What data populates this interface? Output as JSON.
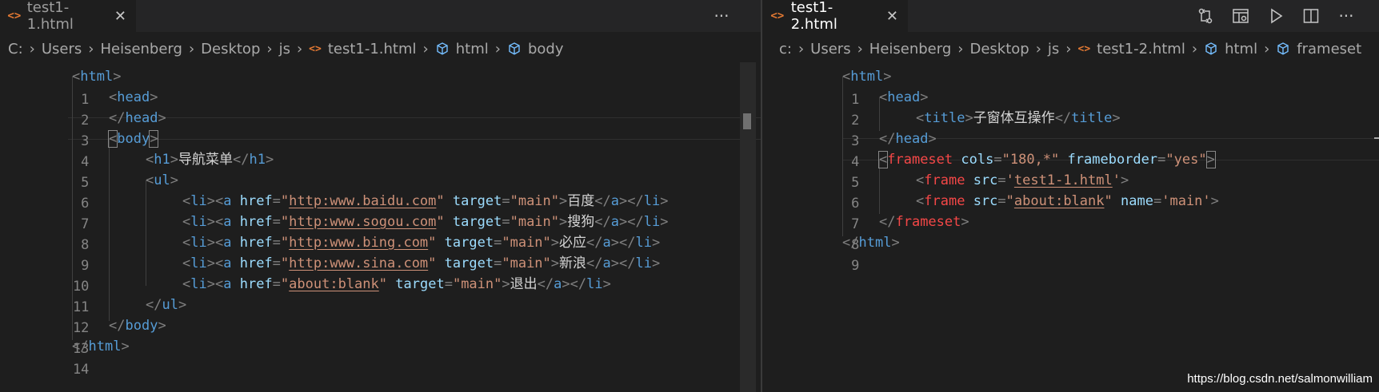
{
  "left": {
    "tab": {
      "title": "test1-1.html",
      "close_glyph": "✕",
      "file_icon": "<>"
    },
    "more_actions": "···",
    "breadcrumb": [
      "C:",
      "Users",
      "Heisenberg",
      "Desktop",
      "js",
      "test1-1.html",
      "html",
      "body"
    ],
    "line_numbers": [
      "1",
      "2",
      "3",
      "4",
      "5",
      "6",
      "7",
      "8",
      "9",
      "10",
      "11",
      "12",
      "13",
      "14"
    ]
  },
  "right": {
    "tab": {
      "title": "test1-2.html",
      "close_glyph": "✕",
      "file_icon": "<>"
    },
    "actions": [
      "compare-changes-icon",
      "open-preview-icon",
      "run-icon",
      "split-editor-icon",
      "more-actions-icon"
    ],
    "more_actions": "···",
    "breadcrumb": [
      "c:",
      "Users",
      "Heisenberg",
      "Desktop",
      "js",
      "test1-2.html",
      "html",
      "frameset"
    ],
    "line_numbers": [
      "1",
      "2",
      "3",
      "4",
      "5",
      "6",
      "7",
      "8",
      "9"
    ]
  },
  "colors": {
    "tag": "#569cd6",
    "attr": "#9cdcfe",
    "string": "#ce9178",
    "error": "#f44747",
    "file_icon": "#e37933"
  },
  "code": {
    "left": {
      "l5": {
        "title": "导航菜单"
      },
      "items": [
        {
          "href": "http:www.baidu.com",
          "target": "main",
          "label": "百度"
        },
        {
          "href": "http:www.sogou.com",
          "target": "main",
          "label": "搜狗"
        },
        {
          "href": "http:www.bing.com",
          "target": "main",
          "label": "必应"
        },
        {
          "href": "http:www.sina.com",
          "target": "main",
          "label": "新浪"
        },
        {
          "href": "about:blank",
          "target": "main",
          "label": "退出"
        }
      ]
    },
    "right": {
      "title": "子窗体互操作",
      "cols": "180,*",
      "frameborder": "yes",
      "frame1_src": "test1-1.html",
      "frame2_src": "about:blank",
      "frame2_name": "main"
    }
  },
  "watermark": "https://blog.csdn.net/salmonwilliam"
}
